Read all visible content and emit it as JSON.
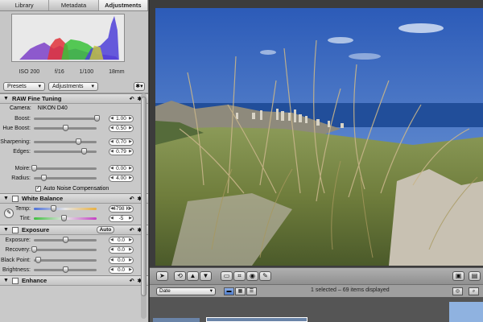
{
  "tabs": [
    {
      "label": "Library"
    },
    {
      "label": "Metadata"
    },
    {
      "label": "Adjustments"
    }
  ],
  "histogram": {
    "iso": "ISO 200",
    "aperture": "f/16",
    "shutter": "1/100",
    "focal": "18mm"
  },
  "toolbar": {
    "presets": "Presets",
    "adjustments": "Adjustments",
    "gear": "✱▾"
  },
  "raw": {
    "title": "RAW Fine Tuning",
    "camera_label": "Camera:",
    "camera_value": "NIKON D40",
    "sliders": [
      {
        "label": "Boost:",
        "value": "1.00",
        "level": 1.0
      },
      {
        "label": "Hue Boost:",
        "value": "0.50",
        "level": 0.5
      },
      {
        "label": "Sharpening:",
        "value": "0.70",
        "level": 0.7
      },
      {
        "label": "Edges:",
        "value": "0.79",
        "level": 0.79
      },
      {
        "label": "Moire:",
        "value": "0.00",
        "level": 0.0
      },
      {
        "label": "Radius:",
        "value": "4.00",
        "level": 0.16
      }
    ],
    "auto_noise": "Auto Noise Compensation"
  },
  "white_balance": {
    "title": "White Balance",
    "temp_label": "Temp:",
    "temp_value": "4798 K",
    "temp_level": 0.31,
    "tint_label": "Tint:",
    "tint_value": "-5",
    "tint_level": 0.47
  },
  "exposure": {
    "title": "Exposure",
    "auto": "Auto",
    "sliders": [
      {
        "label": "Exposure:",
        "value": "0.0",
        "level": 0.5
      },
      {
        "label": "Recovery:",
        "value": "0.0",
        "level": 0.0
      },
      {
        "label": "Black Point:",
        "value": "0.0",
        "level": 0.07
      },
      {
        "label": "Brightness:",
        "value": "0.0",
        "level": 0.5
      }
    ]
  },
  "enhance": {
    "title": "Enhance"
  },
  "status": {
    "sort": "Date",
    "text": "1 selected – 69 items displayed"
  },
  "colors": {
    "sky": "#3f6fc2",
    "grass": "#8a9a55",
    "panel": "#c9c9c9"
  }
}
